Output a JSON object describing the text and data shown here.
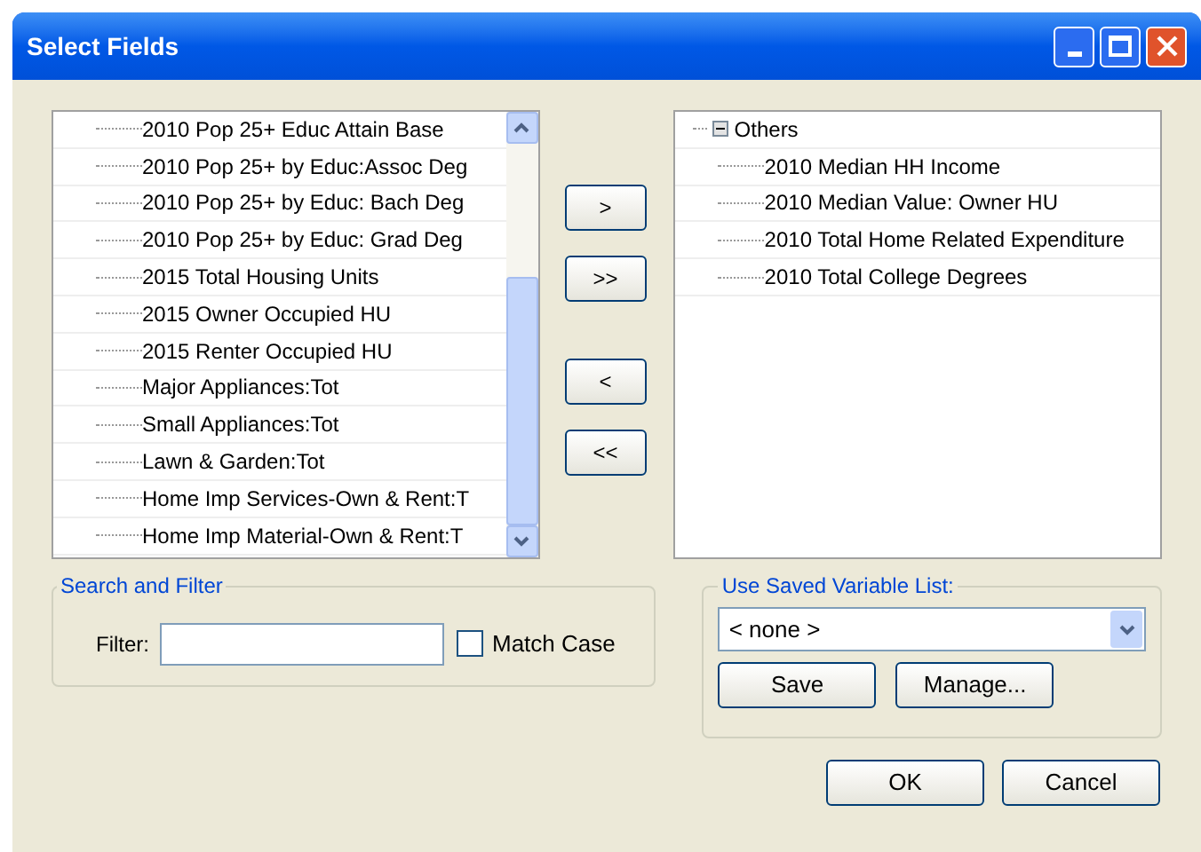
{
  "window": {
    "title": "Select Fields"
  },
  "available_fields": [
    "2010 Pop 25+ Educ Attain Base",
    "2010 Pop 25+ by Educ:Assoc Deg",
    "2010 Pop 25+ by Educ: Bach Deg",
    "2010 Pop 25+ by Educ: Grad Deg",
    "2015 Total Housing Units",
    "2015 Owner Occupied HU",
    "2015 Renter Occupied HU",
    "Major Appliances:Tot",
    "Small Appliances:Tot",
    "Lawn & Garden:Tot",
    "Home Imp Services-Own & Rent:T",
    "Home Imp Material-Own & Rent:T"
  ],
  "move_buttons": [
    ">",
    ">>",
    "<",
    "<<"
  ],
  "selected_fields": {
    "label": "Others",
    "expanded": true,
    "children": [
      "2010 Median HH Income",
      "2010 Median Value: Owner HU",
      "2010 Total Home Related Expenditure",
      "2010 Total College Degrees"
    ]
  },
  "search_and_filter": {
    "title": "Search and Filter",
    "filter_label": "Filter:",
    "match_case": {
      "label": "Match Case",
      "checked": false
    }
  },
  "saved_list": {
    "title": "Use Saved Variable List:",
    "value": "< none >",
    "buttons": [
      "Save",
      "Manage..."
    ]
  },
  "buttons": [
    "OK",
    "Cancel"
  ]
}
